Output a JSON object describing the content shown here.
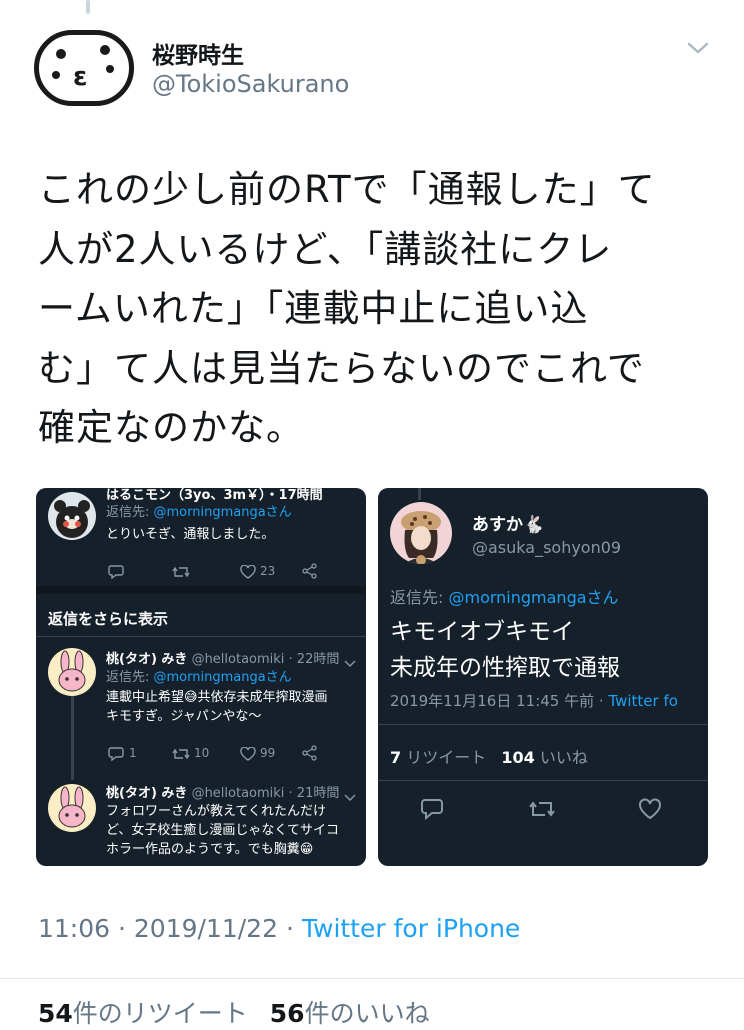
{
  "tweet": {
    "display_name": "桜野時生",
    "handle": "@TokioSakurano",
    "text_lines": [
      "これの少し前のRTで「通報した」て",
      "人が2人いるけど、「講談社にクレ",
      "ームいれた」「連載中止に追い込",
      "む」て人は見当たらないのでこれで",
      "確定なのかな。"
    ],
    "time": "11:06",
    "sep": "·",
    "date": "2019/11/22",
    "client": "Twitter for iPhone",
    "retweets_count": "54",
    "retweets_label": "件のリツイート",
    "likes_count": "56",
    "likes_label": "件のいいね"
  },
  "left_screenshot": {
    "first_reply": {
      "name": "はるこモン（3yo、3m￥）・17時間",
      "reply_to_prefix": "返信先: ",
      "reply_to_user": "@morningmangaさん",
      "text": "とりいそぎ、通報しました。",
      "like_count": "23"
    },
    "show_more": "返信をさらに表示",
    "reply1": {
      "name": "桃(タオ) みき",
      "meta": "@hellotaomiki · 22時間",
      "reply_to_prefix": "返信先: ",
      "reply_to_user": "@morningmangaさん",
      "line1": "連載中止希望😅共依存未成年搾取漫画",
      "line2": "キモすぎ。ジャパンやな〜",
      "reply_count": "1",
      "retweet_count": "10",
      "like_count": "99"
    },
    "reply2": {
      "name": "桃(タオ) みき",
      "meta": "@hellotaomiki · 21時間",
      "line1": "フォロワーさんが教えてくれたんだけ",
      "line2": "ど、女子校生癒し漫画じゃなくてサイコ",
      "line3": "ホラー作品のようです。でも胸糞😁"
    }
  },
  "right_screenshot": {
    "name": "あすか🐇",
    "handle": "@asuka_sohyon09",
    "reply_to_prefix": "返信先: ",
    "reply_to_user": "@morningmangaさん",
    "text_line1": "キモイオブキモイ",
    "text_line2": "未成年の性搾取で通報",
    "timestamp": "2019年11月16日 11:45 午前 · ",
    "client": "Twitter fo",
    "retweets_count": "7",
    "retweets_label": " リツイート",
    "likes_count": "104",
    "likes_label": " いいね"
  },
  "icons": {
    "caret": "chevron-down-icon",
    "reply": "reply-icon",
    "retweet": "retweet-icon",
    "like": "heart-icon",
    "share": "share-icon"
  },
  "colors": {
    "accent": "#1da1f2",
    "dark_bg": "#15202b",
    "muted": "#657786"
  }
}
